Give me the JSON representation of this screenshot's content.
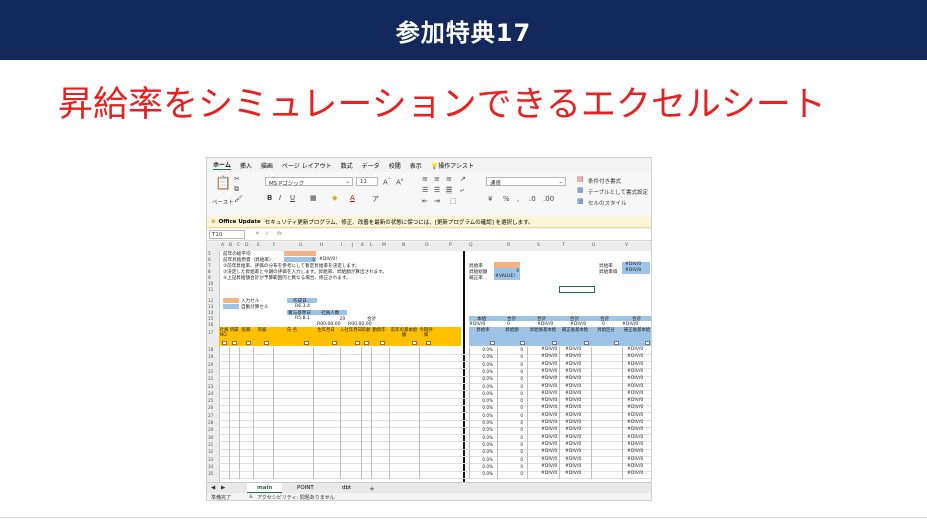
{
  "banner": {
    "title": "参加特典17"
  },
  "headline": "昇給率をシミュレーションできるエクセルシート",
  "excel": {
    "tabs": [
      "ホーム",
      "挿入",
      "描画",
      "ページ レイアウト",
      "数式",
      "データ",
      "校閲",
      "表示"
    ],
    "tell_me": "操作アシスト",
    "paste_label": "ペースト",
    "font_name": "MS Pゴシック",
    "font_size": "11",
    "number_format": "通貨",
    "cond_format": "条件付き書式",
    "table_format": "テーブルとして書式設定",
    "cell_styles": "セルのスタイル",
    "info_title": "Office Update",
    "info_text": "セキュリティ更新プログラム、修正、改善を最新の状態に保つには、[更新プログラムの確認] を選択します。",
    "name_box": "T10",
    "columns": [
      "A",
      "B",
      "C",
      "D",
      "E",
      "F",
      "G",
      "H",
      "I",
      "J",
      "K",
      "L",
      "M",
      "N",
      "O",
      "P",
      "Q",
      "R",
      "S",
      "T",
      "U",
      "V"
    ],
    "note_rows": [
      "②前年昇給率、評価の分布を参考にして暫定昇給率を決定します。",
      "③決定した昇給率と今期の評価を入力します。昇給率、昇給額が算出されます。",
      "④上記昇給額合計が予算範囲内と異なる場合、修正されます。"
    ],
    "label_top1": "前年の総平均",
    "label_top2": "前年昇給原資（昇給率）",
    "err": "#DIV/0!",
    "err_short": "#DIV/0",
    "zero": "0",
    "right_labels": [
      "昇給率",
      "昇給総額",
      "補正率"
    ],
    "right_value2": "0",
    "right_value3": "#VALUE!",
    "far_labels": [
      "昇給率",
      "昇給単価"
    ],
    "legend": [
      "入力セル",
      "自動計算セル"
    ],
    "date_label": "作成日",
    "date_value": "R6.3.4",
    "base_label": "賞与基準日",
    "base_value": "R5.8.1",
    "count_label": "社員人数",
    "count_value": "29",
    "date_hdr1": "R00.00.00",
    "date_hdr2": "R00.00.00",
    "header_cells": [
      "社員NO.",
      "所属",
      "役職",
      "等級",
      "氏 名",
      "生年月日",
      "入社年月日",
      "年齢",
      "勤続年",
      "前年の基本給額",
      "今期評価",
      "昇給率",
      "昇給額",
      "昇給後基本給",
      "補正後基本給",
      "昇給区分",
      "補正後基本給"
    ],
    "section_labels": [
      "合計",
      "本給",
      "合計",
      "合計",
      "合計",
      "合計",
      "合計"
    ],
    "pct": "0.0%",
    "sheet_tabs": [
      "main",
      "POINT",
      "dbt"
    ],
    "status_ready": "準備完了",
    "status_access": "アクセシビリティ: 問題ありません"
  }
}
